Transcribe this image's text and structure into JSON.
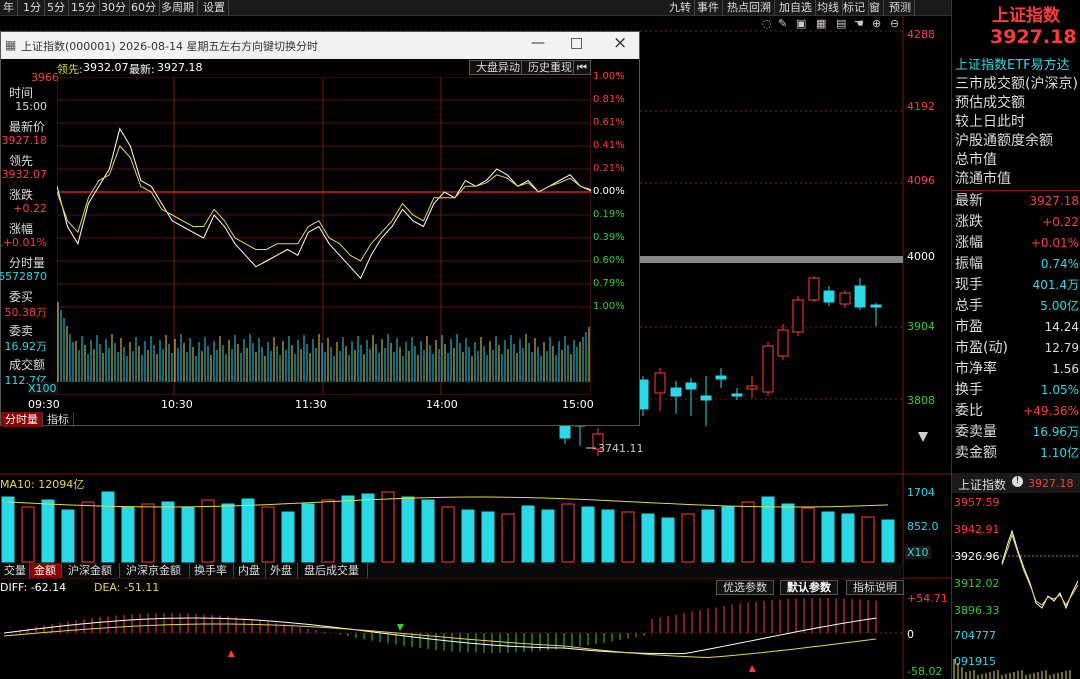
{
  "toolbar": {
    "left": [
      "年",
      "1分",
      "5分",
      "15分",
      "30分",
      "60分",
      "多周期",
      "设置"
    ],
    "right": [
      "九转",
      "事件",
      "热点回溯",
      "加自选",
      "均线",
      "标记",
      "窗",
      "预测"
    ]
  },
  "price_axis": [
    "4288",
    "4192",
    "4096",
    "4000",
    "3904",
    "3808"
  ],
  "low_marker": "3741.11",
  "volume_panel": {
    "ma_label": "MA10: 12094亿",
    "ticks": [
      "1704",
      "852.0"
    ],
    "unit": "X10"
  },
  "bottom_tabs": [
    "交量",
    "金额",
    "沪深金额",
    "沪深京金额",
    "换手率",
    "内盘",
    "外盘",
    "盘后成交量"
  ],
  "macd": {
    "diff": "DIFF: -62.14",
    "dea": "DEA: -51.11",
    "ticks": [
      "+54.71",
      "0",
      "-58.02"
    ],
    "buttons": [
      "优选参数",
      "默认参数",
      "指标说明"
    ]
  },
  "right_panel": {
    "title": "上证指数",
    "price": "3927.18",
    "etf_link": "上证指数ETF易方达",
    "links": [
      "三市成交额(沪深京)",
      "预估成交额",
      "较上日此时",
      "沪股通额度余额",
      "总市值",
      "流通市值"
    ],
    "stats": [
      {
        "label": "最新",
        "value": "3927.18",
        "color": "#ff3b3b"
      },
      {
        "label": "涨跌",
        "value": "+0.22",
        "color": "#ff3b3b"
      },
      {
        "label": "涨幅",
        "value": "+0.01%",
        "color": "#ff3b3b"
      },
      {
        "label": "振幅",
        "value": "0.74%",
        "color": "#2bd8e6"
      },
      {
        "label": "现手",
        "value": "401.4万",
        "color": "#2bd8e6"
      },
      {
        "label": "总手",
        "value": "5.00亿",
        "color": "#2bd8e6"
      },
      {
        "label": "市盈",
        "value": "14.24",
        "color": "#dddddd"
      },
      {
        "label": "市盈(动)",
        "value": "12.79",
        "color": "#dddddd"
      },
      {
        "label": "市净率",
        "value": "1.56",
        "color": "#dddddd"
      },
      {
        "label": "换手",
        "value": "1.05%",
        "color": "#2bd8e6"
      },
      {
        "label": "委比",
        "value": "+49.36%",
        "color": "#ff3b3b"
      },
      {
        "label": "委卖量",
        "value": "16.96万",
        "color": "#2bd8e6"
      },
      {
        "label": "卖金额",
        "value": "1.10亿",
        "color": "#2bd8e6"
      }
    ],
    "mini": {
      "name": "上证指数",
      "price": "3927.18",
      "ticks": [
        "3957.59",
        "3942.91",
        "3926.96",
        "3912.02",
        "3896.33",
        "704777",
        "091915"
      ]
    }
  },
  "popup": {
    "title": "上证指数(000001) 2026-08-14 星期五",
    "hint": "左右方向键切换分时",
    "lead_label": "领先:",
    "lead_value": "3932.07",
    "latest_label": "最新:",
    "latest_value": "3927.18",
    "buttons": [
      "大盘异动",
      "历史重现"
    ],
    "left_ticks": [
      "3966"
    ],
    "pct_ticks": [
      "1.00%",
      "0.81%",
      "0.61%",
      "0.41%",
      "0.21%",
      "0.00%",
      "0.19%",
      "0.39%",
      "0.60%",
      "0.79%",
      "1.00%"
    ],
    "time_ticks": [
      "09:30",
      "10:30",
      "11:30",
      "14:00",
      "15:00"
    ],
    "vol_unit": "X100",
    "tabs": [
      "分时量",
      "指标"
    ],
    "info": [
      {
        "label": "时间",
        "value": "15:00",
        "color": "#dddddd"
      },
      {
        "label": "最新价",
        "value": "3927.18",
        "color": "#ff3b3b"
      },
      {
        "label": "领先",
        "value": "3932.07",
        "color": "#ff3b3b"
      },
      {
        "label": "涨跌",
        "value": "+0.22",
        "color": "#ff3b3b"
      },
      {
        "label": "涨幅",
        "value": "+0.01%",
        "color": "#ff3b3b"
      },
      {
        "label": "分时量",
        "value": "6572870",
        "color": "#2bd8e6"
      },
      {
        "label": "委买",
        "value": "50.38万",
        "color": "#ff3b3b"
      },
      {
        "label": "委卖",
        "value": "16.92万",
        "color": "#2bd8e6"
      },
      {
        "label": "成交额",
        "value": "112.7亿",
        "color": "#2bd8e6"
      }
    ]
  },
  "chart_data": {
    "type": "line",
    "series": [
      {
        "values": [
          0.05,
          -0.3,
          -0.45,
          -0.1,
          0.05,
          0.2,
          0.55,
          0.4,
          0.1,
          0.05,
          -0.1,
          -0.25,
          -0.3,
          -0.35,
          -0.4,
          -0.2,
          -0.3,
          -0.45,
          -0.55,
          -0.65,
          -0.6,
          -0.55,
          -0.5,
          -0.55,
          -0.35,
          -0.3,
          -0.45,
          -0.55,
          -0.65,
          -0.75,
          -0.55,
          -0.4,
          -0.3,
          -0.15,
          -0.25,
          -0.3,
          -0.1,
          0.0,
          -0.05,
          0.1,
          0.05,
          0.1,
          0.2,
          0.15,
          0.05,
          0.1,
          0.0,
          0.05,
          0.1,
          0.15,
          0.05,
          0.01
        ]
      },
      {
        "values": [
          0.0,
          -0.25,
          -0.35,
          -0.05,
          0.1,
          0.15,
          0.4,
          0.3,
          0.05,
          0.0,
          -0.15,
          -0.2,
          -0.25,
          -0.3,
          -0.3,
          -0.15,
          -0.25,
          -0.4,
          -0.45,
          -0.5,
          -0.5,
          -0.45,
          -0.45,
          -0.45,
          -0.3,
          -0.25,
          -0.4,
          -0.45,
          -0.55,
          -0.6,
          -0.45,
          -0.35,
          -0.25,
          -0.1,
          -0.2,
          -0.25,
          -0.05,
          -0.05,
          -0.05,
          0.05,
          0.05,
          0.08,
          0.15,
          0.12,
          0.05,
          0.08,
          0.0,
          0.05,
          0.08,
          0.12,
          0.05,
          0.02
        ]
      }
    ],
    "ylim": [
      -1.0,
      1.0
    ]
  }
}
